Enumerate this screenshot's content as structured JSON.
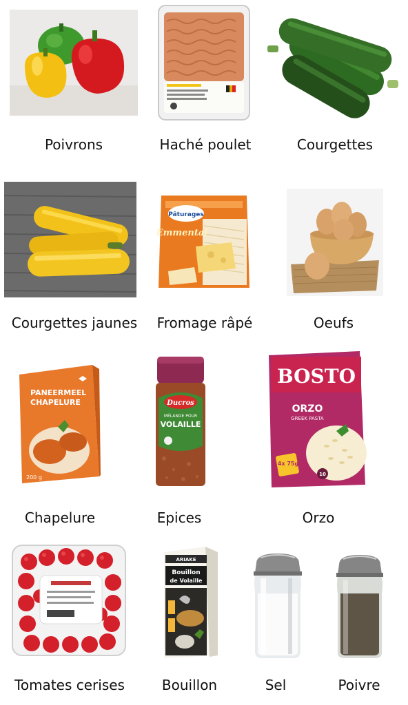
{
  "items": [
    {
      "id": "poivrons",
      "label": "Poivrons"
    },
    {
      "id": "hache-poulet",
      "label": "Haché poulet"
    },
    {
      "id": "courgettes",
      "label": "Courgettes"
    },
    {
      "id": "courgettes-jaunes",
      "label": "Courgettes jaunes"
    },
    {
      "id": "fromage-rape",
      "label": "Fromage râpé"
    },
    {
      "id": "oeufs",
      "label": "Oeufs"
    },
    {
      "id": "chapelure",
      "label": "Chapelure"
    },
    {
      "id": "epices",
      "label": "Epices"
    },
    {
      "id": "orzo",
      "label": "Orzo"
    },
    {
      "id": "tomates-cerises",
      "label": "Tomates cerises"
    },
    {
      "id": "bouillon",
      "label": "Bouillon"
    },
    {
      "id": "sel",
      "label": "Sel"
    },
    {
      "id": "poivre",
      "label": "Poivre"
    }
  ],
  "package_text": {
    "fromage_brand": "Pâturages",
    "fromage_product": "Emmental",
    "chapelure_line1": "PANEERMEEL",
    "chapelure_line2": "CHAPELURE",
    "chapelure_weight": "200 g",
    "epices_brand": "Ducros",
    "epices_line1": "MÉLANGE POUR",
    "epices_line2": "VOLAILLE",
    "orzo_brand": "BOSTO",
    "orzo_product": "ORZO",
    "orzo_sub": "GREEK PASTA",
    "orzo_portions": "4x 75g",
    "orzo_minutes": "10",
    "bouillon_brand": "ARIAKE",
    "bouillon_line1": "Bouillon",
    "bouillon_line2": "de Volaille"
  }
}
